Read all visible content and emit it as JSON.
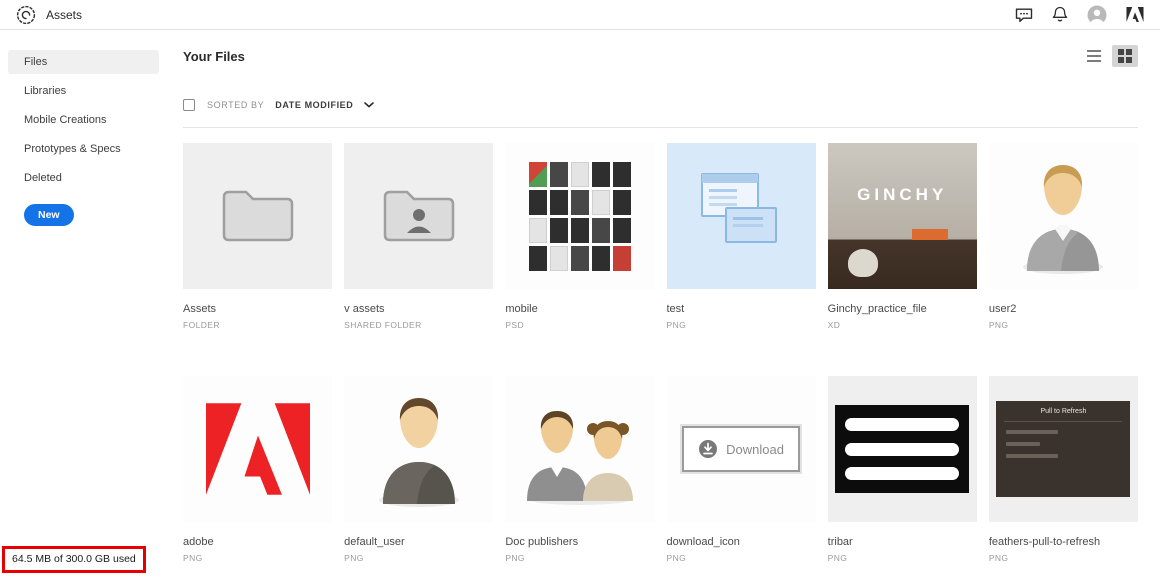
{
  "colors": {
    "accent_blue": "#1473e6",
    "annotation_red": "#e60000",
    "adobe_red": "#ed2224"
  },
  "topbar": {
    "title": "Assets"
  },
  "sidebar": {
    "items": [
      {
        "label": "Files",
        "active": true
      },
      {
        "label": "Libraries",
        "active": false
      },
      {
        "label": "Mobile Creations",
        "active": false
      },
      {
        "label": "Prototypes & Specs",
        "active": false
      },
      {
        "label": "Deleted",
        "active": false
      }
    ],
    "new_button_label": "New",
    "storage_text": "64.5 MB of 300.0 GB used"
  },
  "main": {
    "title": "Your Files",
    "sort": {
      "label": "SORTED BY",
      "value": "DATE MODIFIED"
    },
    "active_view": "grid",
    "files": [
      {
        "name": "Assets",
        "type": "FOLDER"
      },
      {
        "name": "v assets",
        "type": "SHARED FOLDER"
      },
      {
        "name": "mobile",
        "type": "PSD"
      },
      {
        "name": "test",
        "type": "PNG"
      },
      {
        "name": "Ginchy_practice_file",
        "type": "XD",
        "thumb_text": "GINCHY"
      },
      {
        "name": "user2",
        "type": "PNG"
      },
      {
        "name": "adobe",
        "type": "PNG"
      },
      {
        "name": "default_user",
        "type": "PNG"
      },
      {
        "name": "Doc publishers",
        "type": "PNG"
      },
      {
        "name": "download_icon",
        "type": "PNG",
        "thumb_text": "Download"
      },
      {
        "name": "tribar",
        "type": "PNG"
      },
      {
        "name": "feathers-pull-to-refresh",
        "type": "PNG",
        "thumb_text": "Pull to Refresh"
      }
    ]
  }
}
